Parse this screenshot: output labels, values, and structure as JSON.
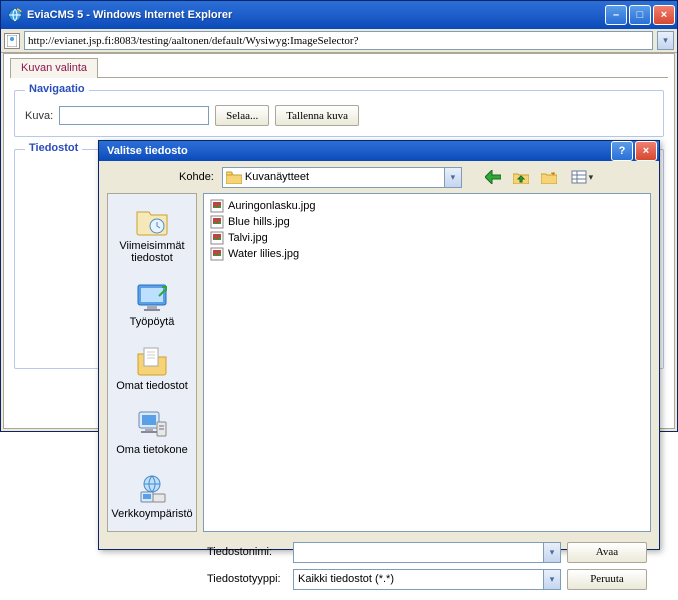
{
  "ie_window": {
    "title": "EviaCMS 5 - Windows Internet Explorer",
    "url": "http://evianet.jsp.fi:8083/testing/aaltonen/default/Wysiwyg:ImageSelector?",
    "min_glyph": "–",
    "max_glyph": "□",
    "close_glyph": "×"
  },
  "page": {
    "tab_label": "Kuvan valinta",
    "fieldset1_legend": "Navigaatio",
    "image_label": "Kuva:",
    "browse_label": "Selaa...",
    "save_label": "Tallenna kuva",
    "fieldset2_legend": "Tiedostot"
  },
  "dialog": {
    "title": "Valitse tiedosto",
    "help_glyph": "?",
    "close_glyph": "×",
    "lookin_label": "Kohde:",
    "lookin_value": "Kuvanäytteet",
    "places": [
      {
        "label_a": "Viimeisimmät",
        "label_b": "tiedostot"
      },
      {
        "label_a": "Työpöytä",
        "label_b": ""
      },
      {
        "label_a": "Omat tiedostot",
        "label_b": ""
      },
      {
        "label_a": "Oma tietokone",
        "label_b": ""
      },
      {
        "label_a": "Verkkoympäristö",
        "label_b": ""
      }
    ],
    "files": [
      "Auringonlasku.jpg",
      "Blue hills.jpg",
      "Talvi.jpg",
      "Water lilies.jpg"
    ],
    "filename_label": "Tiedostonimi:",
    "filename_value": "",
    "filetype_label": "Tiedostotyyppi:",
    "filetype_value": "Kaikki tiedostot (*.*)",
    "open_label": "Avaa",
    "cancel_label": "Peruuta"
  }
}
